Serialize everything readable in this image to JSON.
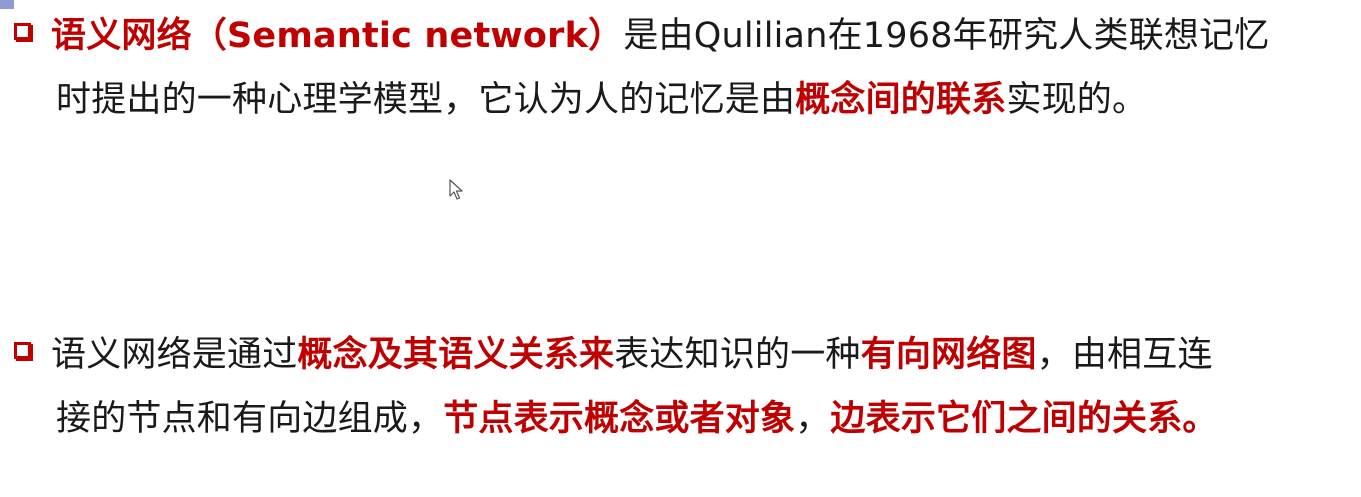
{
  "bullet1": {
    "term": "语义网络（Semantic network）",
    "line1_rest": "是由Qulilian在1968年研究人类联想记忆",
    "line2_a": "时提出的一种心理学模型，它认为人的记忆是由",
    "line2_highlight": "概念间的联系",
    "line2_b": "实现的。"
  },
  "bullet2": {
    "line1_a": "语义网络是通过",
    "line1_highlight1": "概念及其语义关系来",
    "line1_b": "表达知识的一种",
    "line1_highlight2": "有向网络图",
    "line1_c": "，由相互连",
    "line2_a": "接的节点和有向边组成，",
    "line2_highlight1": "节点表示概念或者对象",
    "line2_b": "，",
    "line2_highlight2": "边表示它们之间的关系。"
  },
  "colors": {
    "accent": "#c00000",
    "text": "#1a1a1a",
    "corner": "#8e9bd6"
  },
  "icons": {
    "bullet": "square-bullet-icon",
    "cursor": "mouse-pointer-icon"
  }
}
